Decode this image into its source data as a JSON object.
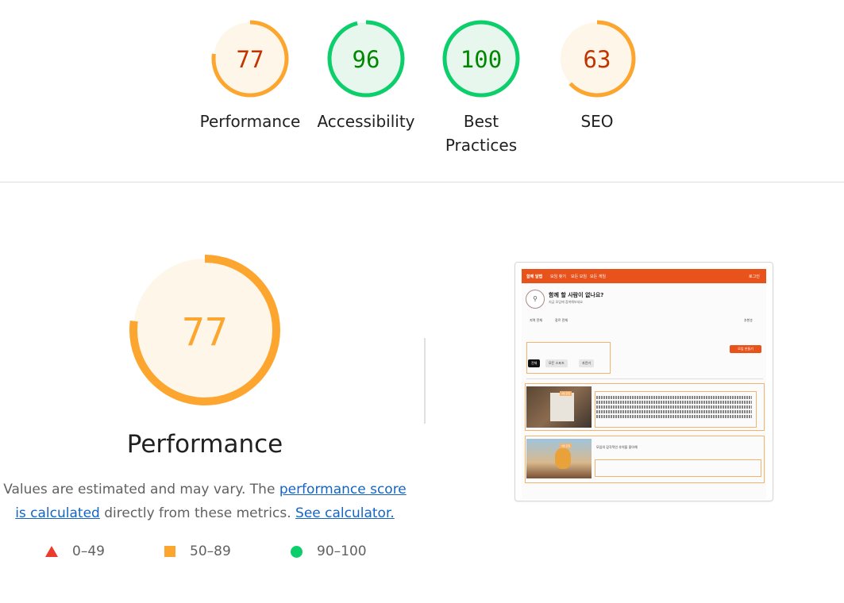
{
  "gauges": [
    {
      "id": "performance",
      "score": "77",
      "label": "Performance",
      "value": 0.77,
      "fill": "#fff6ea",
      "stroke": "#fca630",
      "text_color": "#c33300"
    },
    {
      "id": "accessibility",
      "score": "96",
      "label": "Accessibility",
      "value": 0.96,
      "fill": "#e8f7ee",
      "stroke": "#0cce6b",
      "text_color": "#008800"
    },
    {
      "id": "best-practices",
      "score": "100",
      "label": "Best Practices",
      "value": 1.0,
      "fill": "#e8f7ee",
      "stroke": "#0cce6b",
      "text_color": "#008800"
    },
    {
      "id": "seo",
      "score": "63",
      "label": "SEO",
      "value": 0.63,
      "fill": "#fff6ea",
      "stroke": "#fca630",
      "text_color": "#c33300"
    }
  ],
  "performance": {
    "score": "77",
    "value": 0.77,
    "title": "Performance",
    "fill": "#fff6ea",
    "stroke": "#fca630",
    "score_color": "#fca630",
    "description_prefix": "Values are estimated and may vary. The ",
    "score_link": "performance score is calculated",
    "description_middle": " directly from these metrics.",
    "calculator_link": "See calculator."
  },
  "legend": [
    {
      "shape": "triangle",
      "range": "0–49",
      "color": "#eb3b2f"
    },
    {
      "shape": "square",
      "range": "50–89",
      "color": "#fca630"
    },
    {
      "shape": "circle",
      "range": "90–100",
      "color": "#0cce6b"
    }
  ],
  "thumbnail": {
    "nav": [
      "함께 달랩",
      "모임 찾기",
      "모든 모임",
      "모든 게임",
      "로그인"
    ],
    "title": "함께 할 사람이 없나요?",
    "subtitle": "지금 모임에 참여해보세요",
    "filters": [
      "지역 전체",
      "장르 전체",
      "추천순"
    ],
    "action_button": "모임 만들기",
    "chips": [
      "전체",
      "모든 스포츠",
      "자전거"
    ],
    "card_tags": [
      "4월 모임",
      "3월 모임"
    ],
    "card2_title": "모임의 감각적인 추억을 좋아해"
  }
}
